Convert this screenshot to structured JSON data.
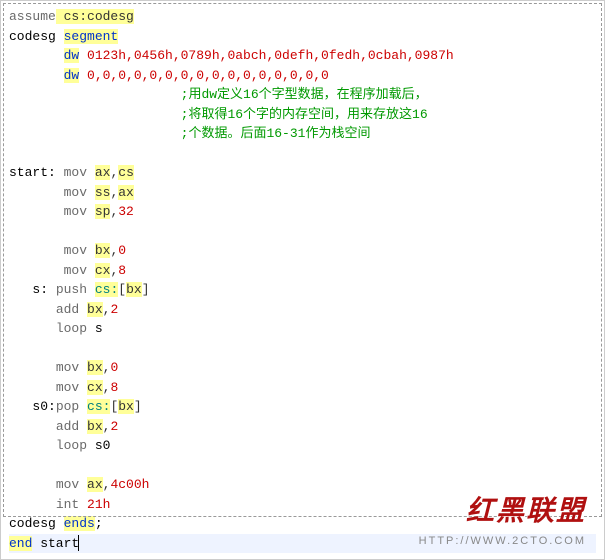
{
  "l1": {
    "kw": "assume",
    "rest": " cs:codesg"
  },
  "l2": {
    "name": "codesg",
    "seg": "segment"
  },
  "l3": {
    "kw": "dw",
    "args": " 0123h,0456h,0789h,0abch,0defh,0fedh,0cbah,0987h"
  },
  "l4": {
    "kw": "dw",
    "args": " 0,0,0,0,0,0,0,0,0,0,0,0,0,0,0,0"
  },
  "c1": ";用dw定义16个字型数据，在程序加载后，",
  "c2": ";将取得16个字的内存空间，用来存放这16",
  "c3": ";个数据。后面16-31作为栈空间",
  "start_lbl": "start:",
  "s_lbl": "s:",
  "s0_lbl": "s0:",
  "mn": {
    "mov": "mov",
    "push": "push",
    "add": "add",
    "loop": "loop",
    "pop": "pop",
    "int": "int"
  },
  "r": {
    "ax": "ax",
    "cs": "cs",
    "ss": "ss",
    "sp": "sp",
    "bx": "bx",
    "cx": "cx"
  },
  "v": {
    "n0": "0",
    "n2": "2",
    "n8": "8",
    "n32": "32",
    "ax4c": "4c00h",
    "i21": "21h"
  },
  "seg": {
    "cspfx": "cs:",
    "br_open": "[",
    "br": "bx",
    "br_close": "]"
  },
  "loop_s": "s",
  "loop_s0": "s0",
  "l_ends": {
    "name": "codesg",
    "kw": "ends",
    "semi": ";"
  },
  "l_end": {
    "kw": "end",
    "arg": " start"
  },
  "watermark": "红黑联盟",
  "watermark2": "HTTP://WWW.2CTO.COM"
}
